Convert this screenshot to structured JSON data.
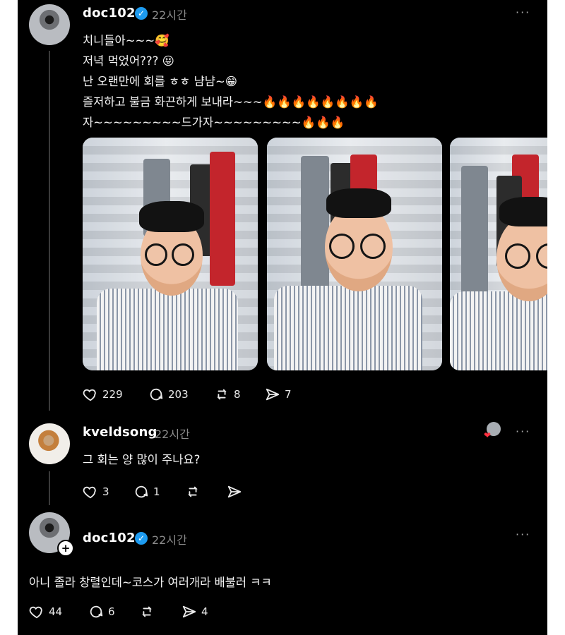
{
  "post": {
    "username": "doc102",
    "time": "22시간",
    "more_label": "···",
    "lines": [
      "치니들아~~~🥰",
      "저녁 먹었어??? 😝",
      "난 오랜만에 회를 ㅎㅎ 냠냠~😁",
      "즐저하고 불금 화끈하게 보내라~~~🔥🔥🔥🔥🔥🔥🔥🔥",
      "자~~~~~~~~~드가자~~~~~~~~~🔥🔥🔥"
    ],
    "actions": {
      "likes": "229",
      "comments": "203",
      "reposts": "8",
      "shares": "7"
    }
  },
  "reply1": {
    "username": "kveldsong",
    "time": "22시간",
    "text": "그 회는 양 많이 주나요?",
    "more_label": "···",
    "actions": {
      "likes": "3",
      "comments": "1"
    }
  },
  "reply2": {
    "username": "doc102",
    "time": "22시간",
    "text": "아니 졸라 창렬인데~코스가 여러개라 배불러 ㅋㅋ",
    "more_label": "···",
    "actions": {
      "likes": "44",
      "comments": "6",
      "shares": "4"
    }
  },
  "icons": {
    "verified": "verified-badge-icon",
    "like": "heart-icon",
    "comment": "comment-bubble-icon",
    "repost": "repost-icon",
    "share": "send-icon",
    "more": "more-dots-icon",
    "follow": "plus-icon"
  },
  "colors": {
    "background": "#000000",
    "text": "#f5f5f5",
    "muted": "#8b8b8b",
    "verified": "#1d9bf0"
  }
}
